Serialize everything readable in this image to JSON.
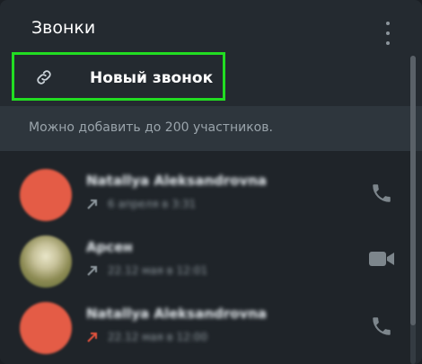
{
  "header": {
    "title": "Звонки"
  },
  "new_call": {
    "label": "Новый звонок"
  },
  "info": {
    "text": "Можно добавить до 200 участников."
  },
  "calls": [
    {
      "name": "Natallya Aleksandrovna",
      "time": "6 апреля в 3:31",
      "direction": "outgoing",
      "action": "phone"
    },
    {
      "name": "Арсен",
      "time": "22.12 мая в 12:01",
      "direction": "outgoing",
      "action": "video"
    },
    {
      "name": "Natallya Aleksandrovna",
      "time": "22.12 мая в 12:00",
      "direction": "missed",
      "action": "phone"
    }
  ],
  "colors": {
    "accent_highlight": "#22dd22",
    "avatar_orange": "#e45c46",
    "missed": "#e5533d"
  },
  "icons": {
    "link": "link-icon",
    "more": "more-vertical-icon",
    "phone": "phone-icon",
    "video": "video-icon"
  }
}
